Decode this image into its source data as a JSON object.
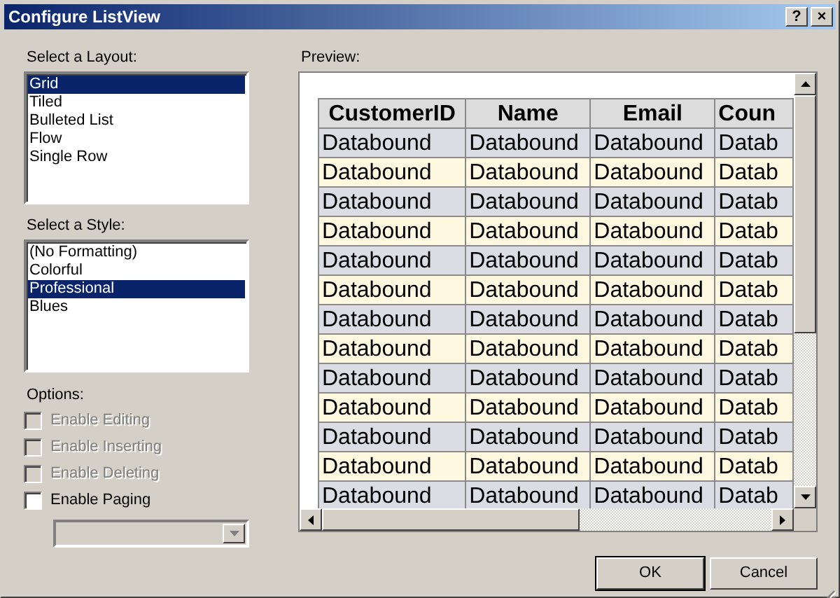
{
  "window": {
    "title": "Configure ListView",
    "buttons": [
      "?",
      "×"
    ]
  },
  "layout": {
    "label": "Select a Layout:",
    "items": [
      {
        "label": "Grid",
        "selected": true
      },
      {
        "label": "Tiled",
        "selected": false
      },
      {
        "label": "Bulleted List",
        "selected": false
      },
      {
        "label": "Flow",
        "selected": false
      },
      {
        "label": "Single Row",
        "selected": false
      }
    ]
  },
  "style": {
    "label": "Select a Style:",
    "items": [
      {
        "label": "(No Formatting)",
        "selected": false
      },
      {
        "label": "Colorful",
        "selected": false
      },
      {
        "label": "Professional",
        "selected": true
      },
      {
        "label": "Blues",
        "selected": false
      }
    ]
  },
  "options": {
    "label": "Options:",
    "items": [
      {
        "label": "Enable Editing",
        "checked": false,
        "disabled": true
      },
      {
        "label": "Enable Inserting",
        "checked": false,
        "disabled": true
      },
      {
        "label": "Enable Deleting",
        "checked": false,
        "disabled": true
      },
      {
        "label": "Enable Paging",
        "checked": false,
        "disabled": false
      }
    ]
  },
  "paging_dropdown": {
    "disabled": true
  },
  "preview": {
    "label": "Preview:",
    "columns": [
      "CustomerID",
      "Name",
      "Email",
      "Coun"
    ],
    "rows": [
      {
        "alternate": false,
        "cells": [
          "Databound",
          "Databound",
          "Databound",
          "Datab"
        ]
      },
      {
        "alternate": true,
        "cells": [
          "Databound",
          "Databound",
          "Databound",
          "Datab"
        ]
      },
      {
        "alternate": false,
        "cells": [
          "Databound",
          "Databound",
          "Databound",
          "Datab"
        ]
      },
      {
        "alternate": true,
        "cells": [
          "Databound",
          "Databound",
          "Databound",
          "Datab"
        ]
      },
      {
        "alternate": false,
        "cells": [
          "Databound",
          "Databound",
          "Databound",
          "Datab"
        ]
      },
      {
        "alternate": true,
        "cells": [
          "Databound",
          "Databound",
          "Databound",
          "Datab"
        ]
      },
      {
        "alternate": false,
        "cells": [
          "Databound",
          "Databound",
          "Databound",
          "Datab"
        ]
      },
      {
        "alternate": true,
        "cells": [
          "Databound",
          "Databound",
          "Databound",
          "Datab"
        ]
      },
      {
        "alternate": false,
        "cells": [
          "Databound",
          "Databound",
          "Databound",
          "Datab"
        ]
      },
      {
        "alternate": true,
        "cells": [
          "Databound",
          "Databound",
          "Databound",
          "Datab"
        ]
      },
      {
        "alternate": false,
        "cells": [
          "Databound",
          "Databound",
          "Databound",
          "Datab"
        ]
      },
      {
        "alternate": true,
        "cells": [
          "Databound",
          "Databound",
          "Databound",
          "Datab"
        ]
      },
      {
        "alternate": false,
        "cells": [
          "Databound",
          "Databound",
          "Databound",
          "Datab"
        ]
      }
    ]
  },
  "buttons": [
    {
      "label": "OK",
      "default": true
    },
    {
      "label": "Cancel",
      "default": false
    }
  ]
}
